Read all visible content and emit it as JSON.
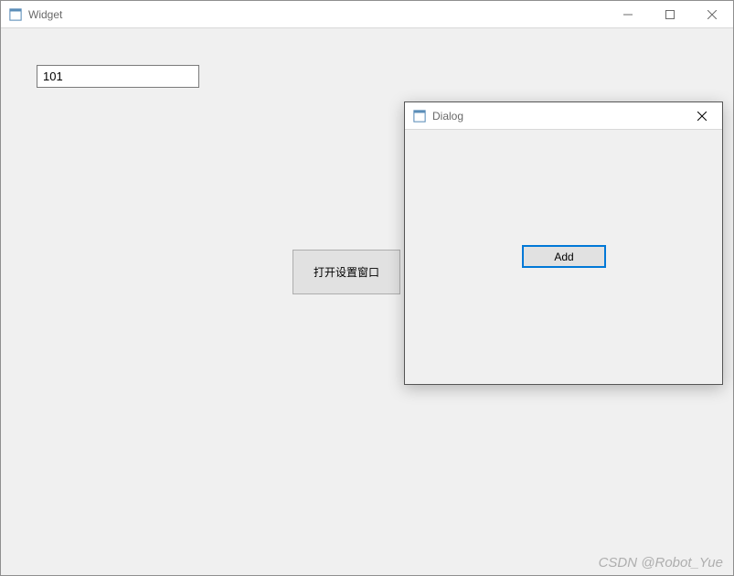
{
  "mainWindow": {
    "title": "Widget",
    "inputValue": "101",
    "openSettingsButton": "打开设置窗口"
  },
  "dialog": {
    "title": "Dialog",
    "addButton": "Add"
  },
  "watermark": "CSDN @Robot_Yue"
}
